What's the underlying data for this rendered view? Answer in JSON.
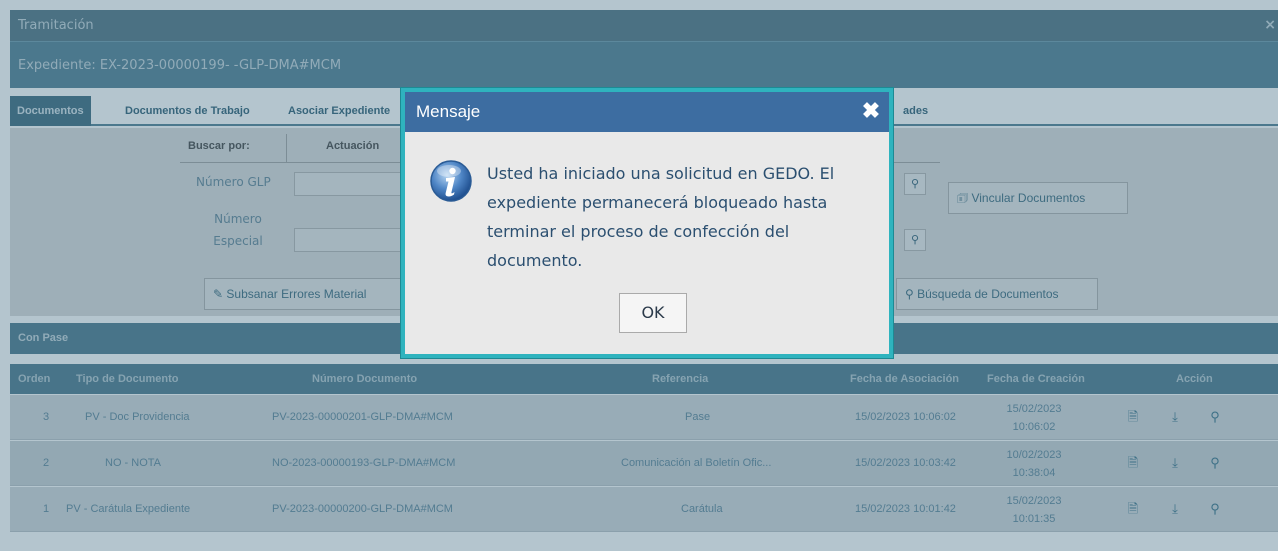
{
  "window": {
    "title": "Tramitación",
    "close_symbol": "×"
  },
  "expediente": {
    "label": "Expediente: EX-2023-00000199- -GLP-DMA#MCM"
  },
  "tabs": [
    {
      "label": "Documentos"
    },
    {
      "label": "Documentos de Trabajo"
    },
    {
      "label": "Asociar Expediente"
    },
    {
      "label": "ades"
    }
  ],
  "search": {
    "buscar_por": "Buscar por:",
    "actuacion": "Actuación",
    "numero_glp": "Número GLP",
    "numero_especial": "Número Especial",
    "vincular_documentos": "Vincular Documentos",
    "subsanar": "Subsanar Errores Material",
    "busqueda_documentos": "Búsqueda de Documentos"
  },
  "section": {
    "title": "Con Pase"
  },
  "table": {
    "headers": {
      "orden": "Orden",
      "tipo": "Tipo de Documento",
      "numero": "Número Documento",
      "referencia": "Referencia",
      "fecha_asoc": "Fecha de Asociación",
      "fecha_crea": "Fecha de Creación",
      "accion": "Acción"
    },
    "rows": [
      {
        "orden": "3",
        "tipo": "PV - Doc Providencia",
        "numero": "PV-2023-00000201-GLP-DMA#MCM",
        "referencia": "Pase",
        "fecha_asoc": "15/02/2023 10:06:02",
        "fecha_crea_d": "15/02/2023",
        "fecha_crea_t": "10:06:02"
      },
      {
        "orden": "2",
        "tipo": "NO - NOTA",
        "numero": "NO-2023-00000193-GLP-DMA#MCM",
        "referencia": "Comunicación al Boletín Ofic...",
        "fecha_asoc": "15/02/2023 10:03:42",
        "fecha_crea_d": "10/02/2023",
        "fecha_crea_t": "10:38:04"
      },
      {
        "orden": "1",
        "tipo": "PV - Carátula Expediente",
        "numero": "PV-2023-00000200-GLP-DMA#MCM",
        "referencia": "Carátula",
        "fecha_asoc": "15/02/2023 10:01:42",
        "fecha_crea_d": "15/02/2023",
        "fecha_crea_t": "10:01:35"
      }
    ],
    "action_icons": [
      "document-icon",
      "download-icon",
      "search-icon"
    ]
  },
  "modal": {
    "title": "Mensaje",
    "close_symbol": "✖",
    "message": "Usted ha iniciado una solicitud en GEDO. El expediente permanecerá bloqueado hasta terminar el proceso de confección del documento.",
    "ok_label": "OK",
    "icon": "info-icon"
  },
  "colors": {
    "modal_header": "#3d6da1",
    "modal_border": "#2fb3be",
    "header_bar": "#5f899c"
  }
}
